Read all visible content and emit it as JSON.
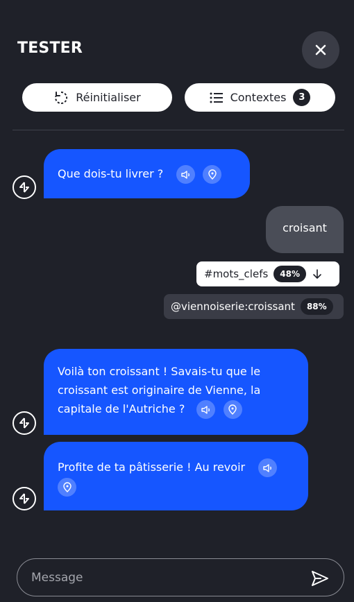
{
  "header": {
    "title": "TESTER"
  },
  "actions": {
    "reset_label": "Réinitialiser",
    "contexts_label": "Contextes",
    "contexts_count": "3"
  },
  "messages": {
    "bot1": "Que dois-tu livrer ?",
    "user1": "croisant",
    "bot2": "Voilà ton croissant ! Savais-tu que le croissant est originaire de Vienne, la capitale de l'Autriche ?",
    "bot3": "Profite de ta pâtisserie ! Au revoir"
  },
  "nlu": {
    "intent_label": "#mots_clefs",
    "intent_score": "48%",
    "entity_label": "@viennoiserie:croissant",
    "entity_score": "88%"
  },
  "composer": {
    "placeholder": "Message"
  },
  "colors": {
    "background": "#1f2129",
    "bot_bubble": "#1656ff",
    "user_bubble": "#4a4d57"
  }
}
